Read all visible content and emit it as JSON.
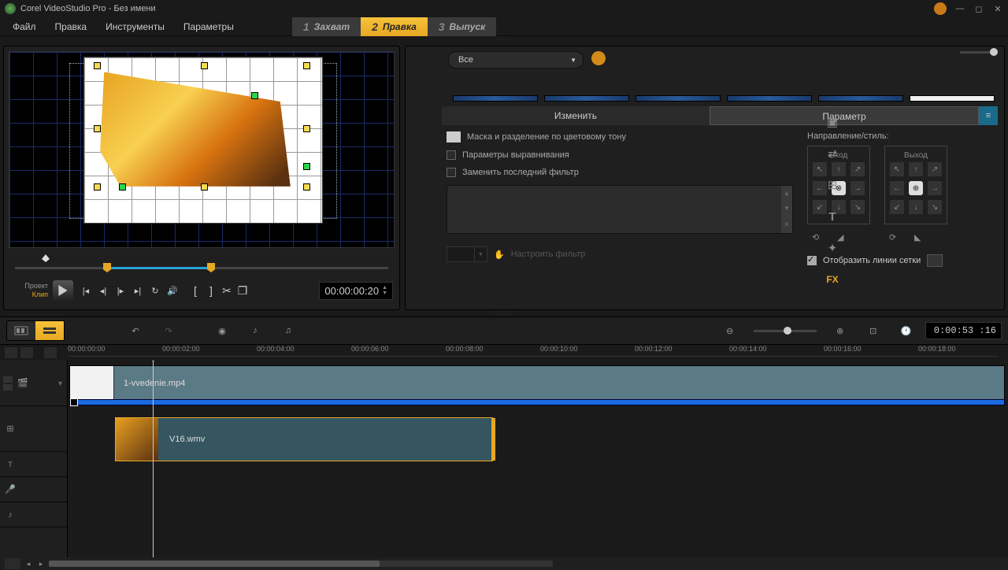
{
  "app": {
    "title": "Corel VideoStudio Pro - Без имени"
  },
  "menu": {
    "file": "Файл",
    "edit": "Правка",
    "tools": "Инструменты",
    "params": "Параметры"
  },
  "stages": {
    "s1": "Захват",
    "s2": "Правка",
    "s3": "Выпуск",
    "n1": "1",
    "n2": "2",
    "n3": "3"
  },
  "preview": {
    "project": "Проект",
    "clip": "Клип",
    "timecode": "00:00:00:20"
  },
  "lib": {
    "combo": "Все",
    "tab_edit": "Изменить",
    "tab_param": "Параметр"
  },
  "opts": {
    "mask": "Маска и разделение по цветовому тону",
    "align": "Параметры выравнивания",
    "replace": "Заменить последний фильтр",
    "custom": "Настроить фильтр"
  },
  "dir": {
    "label": "Направление/стиль:",
    "in": "Вход",
    "out": "Выход",
    "grid": "Отобразить линии сетки"
  },
  "ruler": {
    "t0": "00:00:00:00",
    "t1": "00:00:02:00",
    "t2": "00:00:04:00",
    "t3": "00:00:06:00",
    "t4": "00:00:08:00",
    "t5": "00:00:10:00",
    "t6": "00:00:12:00",
    "t7": "00:00:14:00",
    "t8": "00:00:16:00",
    "t9": "00:00:18:00"
  },
  "timeline": {
    "duration": "0:00:53 :16",
    "clip1": "1-vvedenie.mp4",
    "clip2": "V16.wmv"
  }
}
